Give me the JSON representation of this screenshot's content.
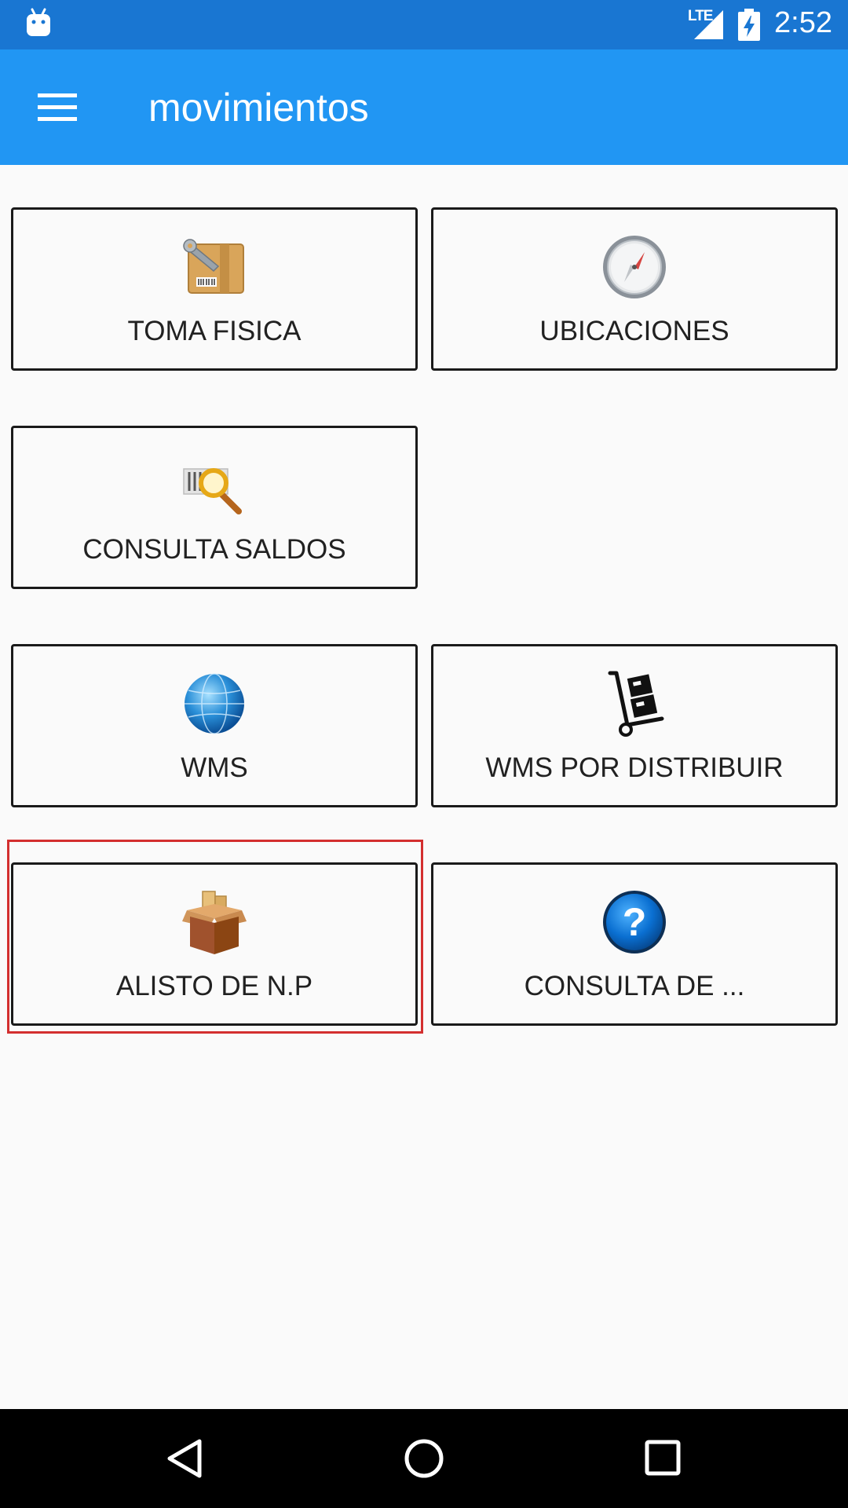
{
  "status_bar": {
    "network": "LTE",
    "time": "2:52",
    "icons": [
      "android-debug-icon",
      "signal-icon",
      "battery-charging-icon"
    ]
  },
  "app_bar": {
    "title": "movimientos",
    "menu_icon": "hamburger-menu-icon"
  },
  "tiles": [
    {
      "label": "TOMA FISICA",
      "icon": "box-wrench-icon"
    },
    {
      "label": "UBICACIONES",
      "icon": "compass-icon"
    },
    {
      "label": "CONSULTA SALDOS",
      "icon": "barcode-search-icon"
    },
    {
      "label": "WMS",
      "icon": "globe-icon"
    },
    {
      "label": "WMS POR DISTRIBUIR",
      "icon": "hand-truck-icon"
    },
    {
      "label": "ALISTO DE N.P",
      "icon": "open-box-icon"
    },
    {
      "label": "CONSULTA DE ...",
      "icon": "help-question-icon"
    }
  ],
  "highlight_color": "#d32f2f",
  "colors": {
    "status_bar": "#1976d2",
    "app_bar": "#2196f3",
    "background": "#fafafa"
  },
  "nav_bar": {
    "icons": [
      "back-icon",
      "home-icon",
      "recents-icon"
    ]
  }
}
